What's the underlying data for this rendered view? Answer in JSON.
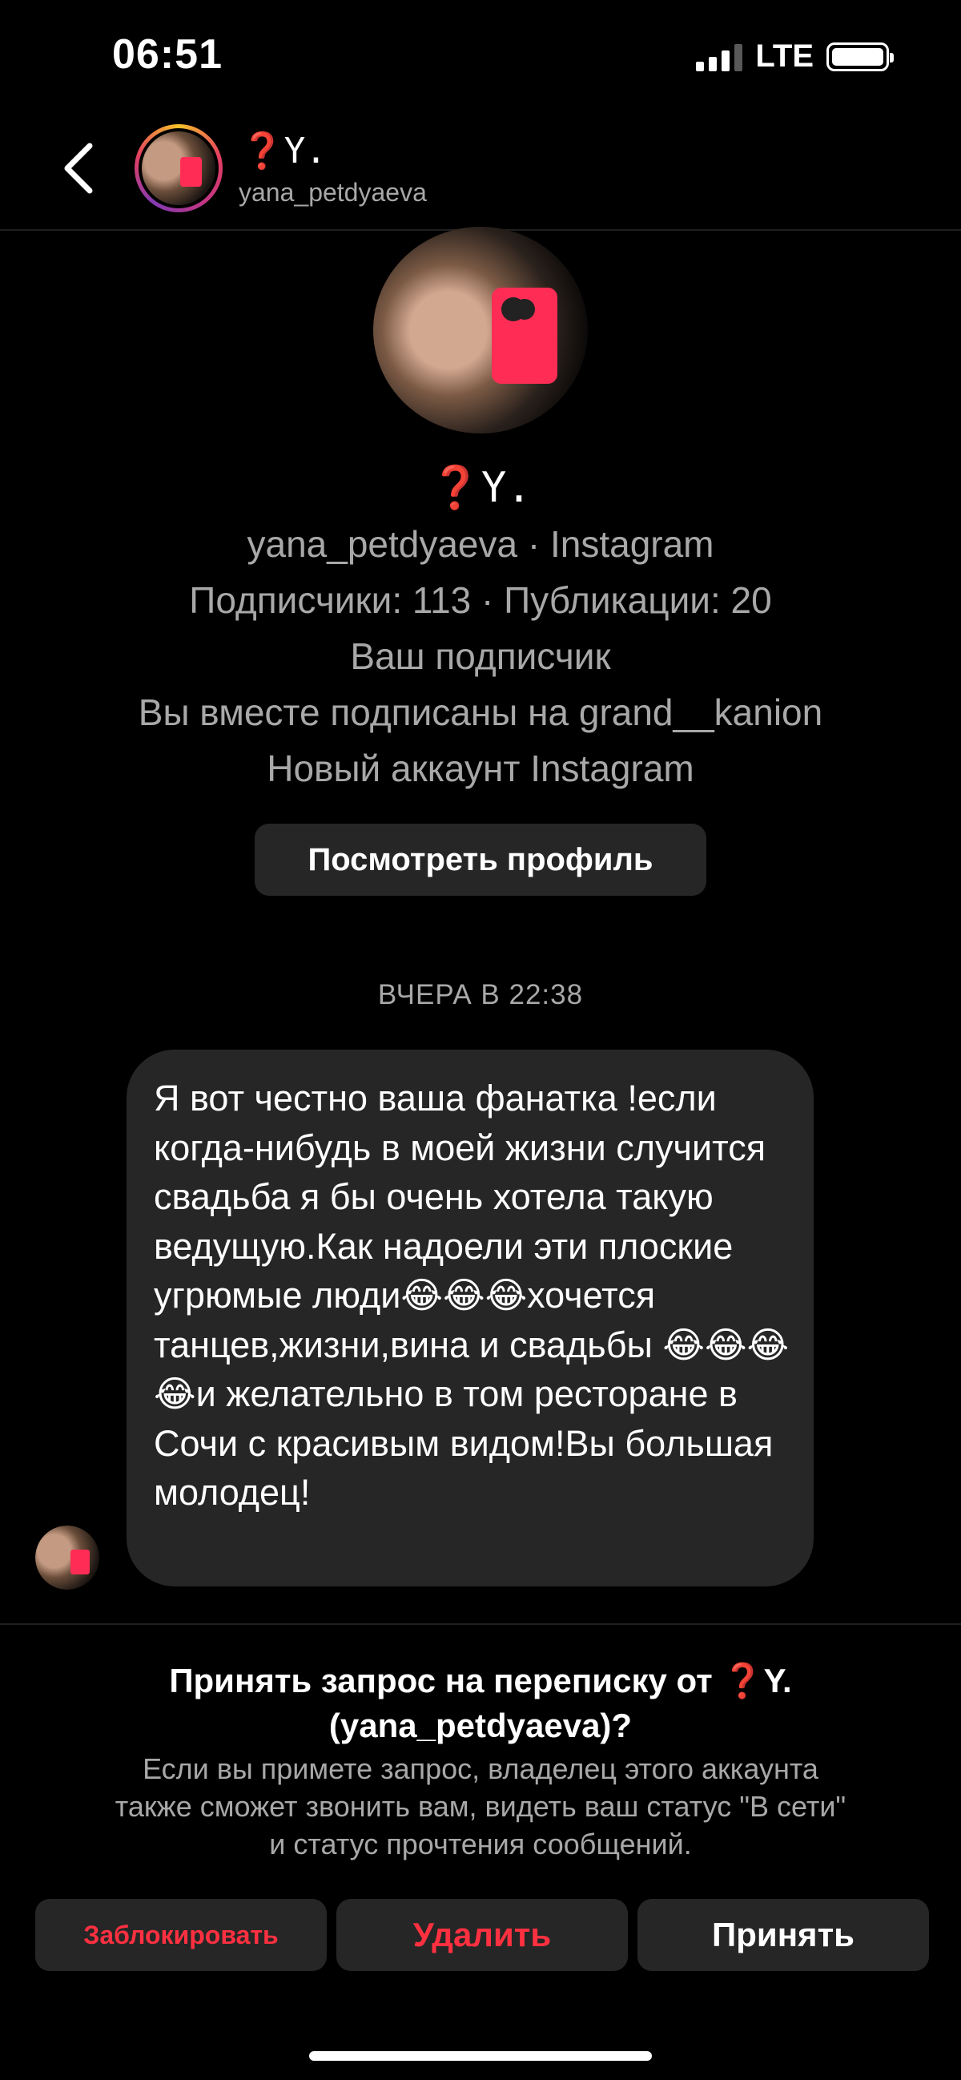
{
  "status_bar": {
    "time": "06:51",
    "network": "LTE"
  },
  "header": {
    "name": "❓Y.",
    "username": "yana_petdyaeva"
  },
  "profile": {
    "name": "❓Y.",
    "source_line": "yana_petdyaeva · Instagram",
    "stats": "Подписчики: 113 · Публикации: 20",
    "follow_status": "Ваш подписчик",
    "mutual": "Вы вместе подписаны на grand__kanion",
    "account_note": "Новый аккаунт Instagram",
    "view_profile_label": "Посмотреть профиль"
  },
  "chat": {
    "timestamp": "ВЧЕРА В 22:38",
    "message": "Я вот честно ваша фанатка !если когда-нибудь в моей жизни случится свадьба я бы очень хотела такую ведущую.Как надоели эти плоские угрюмые люди😂😂😂хочется танцев,жизни,вина и свадьбы 😂😂😂😂и желательно в том ресторане в Сочи с красивым видом!Вы большая молодец!"
  },
  "request": {
    "title_line1": "Принять запрос на переписку от ❓Y.",
    "title_line2": "(yana_petdyaeva)?",
    "desc_line1": "Если вы примете запрос, владелец этого аккаунта",
    "desc_line2": "также сможет звонить вам, видеть ваш статус \"В сети\"",
    "desc_line3": "и статус прочтения сообщений.",
    "block_label": "Заблокировать",
    "delete_label": "Удалить",
    "accept_label": "Принять"
  },
  "colors": {
    "background": "#000000",
    "surface": "#262626",
    "secondary_text": "#a8a8a8",
    "danger": "#ff3040"
  }
}
